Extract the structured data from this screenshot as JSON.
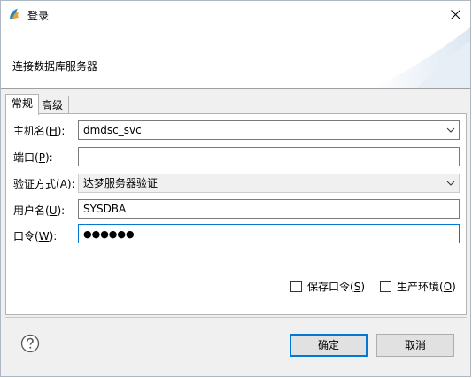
{
  "window": {
    "title": "登录"
  },
  "banner": {
    "message": "连接数据库服务器"
  },
  "tabs": [
    {
      "label": "常规",
      "active": true
    },
    {
      "label": "高级",
      "active": false
    }
  ],
  "form": {
    "host": {
      "label": "主机名(",
      "mnemonic": "H",
      "suffix": "):",
      "value": "dmdsc_svc"
    },
    "port": {
      "label": "端口(",
      "mnemonic": "P",
      "suffix": "):",
      "value": ""
    },
    "auth": {
      "label": "验证方式(",
      "mnemonic": "A",
      "suffix": "):",
      "value": "达梦服务器验证"
    },
    "user": {
      "label": "用户名(",
      "mnemonic": "U",
      "suffix": "):",
      "value": "SYSDBA"
    },
    "password": {
      "label": "口令(",
      "mnemonic": "W",
      "suffix": "):",
      "masked": "●●●●●●"
    }
  },
  "options": {
    "save_password": {
      "label": "保存口令(",
      "mnemonic": "S",
      "suffix": ")",
      "checked": false
    },
    "production": {
      "label": "生产环境(",
      "mnemonic": "O",
      "suffix": ")",
      "checked": false
    }
  },
  "buttons": {
    "ok": "确定",
    "cancel": "取消"
  },
  "colors": {
    "accent": "#0078d7",
    "border": "#7a7a7a",
    "panel_bg": "#f0f0f0"
  }
}
